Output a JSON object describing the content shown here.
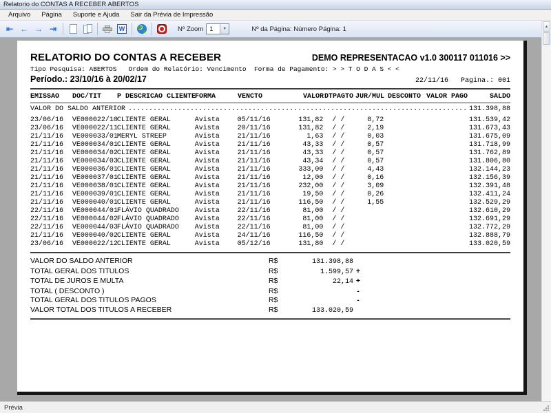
{
  "window": {
    "title": "Relatorio do CONTAS A RECEBER ABERTOS"
  },
  "menu": {
    "items": [
      {
        "label": "Arquivo"
      },
      {
        "label": "Página"
      },
      {
        "label": "Suporte e Ajuda"
      },
      {
        "label": "Sair da Prévia de Impressão"
      }
    ]
  },
  "toolbar": {
    "icons": [
      "first-page-icon",
      "prev-page-icon",
      "next-page-icon",
      "last-page-icon",
      "single-page-icon",
      "two-pages-icon",
      "printer-icon",
      "word-export-icon",
      "globe-icon",
      "pdf-export-icon"
    ],
    "zoom_label": "Nº Zoom",
    "zoom_value": "1",
    "page_info": "Nº da Página: Número Página: 1",
    "colors": {
      "nav_arrow_blue": "#3a6fd2",
      "pdf_red": "#c9201d",
      "word_blue": "#2b50c0"
    }
  },
  "report": {
    "title": "RELATORIO DO CONTAS A RECEBER",
    "demo_header": "DEMO REPRESENTACAO v1.0 300117 011016 >>",
    "filters": "Tipo Pesquisa: ABERTOS   Ordem do Relatório: Vencimento  Forma de Pagamento: > > T O D A S < <",
    "period": "Período.: 23/10/16 à 20/02/17",
    "date_page": "22/11/16   Pagina.: 001",
    "header": {
      "emissao": "EMISSAO",
      "doc": "DOC/TIT",
      "cliente": "P DESCRICAO CLIENTE",
      "forma": "FORMA",
      "vencto": "VENCTO",
      "valor": "VALOR",
      "dtpagto": "DTPAGTO",
      "jur": "JUR/MUL",
      "desconto": "DESCONTO",
      "pago": "VALOR PAGO",
      "saldo": "SALDO"
    },
    "saldo_anterior": {
      "label": "VALOR DO SALDO ANTERIOR",
      "dots": "......................................................................................................................................................",
      "value": "131.398,88"
    },
    "rows": [
      {
        "emissao": "23/06/16",
        "doc": "VE000022/10",
        "cliente": "CLIENTE GERAL",
        "forma": "Avista",
        "vencto": "05/11/16",
        "valor": "131,82",
        "dtpagto": "/ /",
        "jur": "8,72",
        "desconto": "",
        "pago": "",
        "saldo": "131.539,42"
      },
      {
        "emissao": "23/06/16",
        "doc": "VE000022/11",
        "cliente": "CLIENTE GERAL",
        "forma": "Avista",
        "vencto": "20/11/16",
        "valor": "131,82",
        "dtpagto": "/ /",
        "jur": "2,19",
        "desconto": "",
        "pago": "",
        "saldo": "131.673,43"
      },
      {
        "emissao": "21/11/16",
        "doc": "VE000033/01",
        "cliente": "MERYL STREEP",
        "forma": "Avista",
        "vencto": "21/11/16",
        "valor": "1,63",
        "dtpagto": "/ /",
        "jur": "0,03",
        "desconto": "",
        "pago": "",
        "saldo": "131.675,09"
      },
      {
        "emissao": "21/11/16",
        "doc": "VE000034/01",
        "cliente": "CLIENTE GERAL",
        "forma": "Avista",
        "vencto": "21/11/16",
        "valor": "43,33",
        "dtpagto": "/ /",
        "jur": "0,57",
        "desconto": "",
        "pago": "",
        "saldo": "131.718,99"
      },
      {
        "emissao": "21/11/16",
        "doc": "VE000034/02",
        "cliente": "CLIENTE GERAL",
        "forma": "Avista",
        "vencto": "21/11/16",
        "valor": "43,33",
        "dtpagto": "/ /",
        "jur": "0,57",
        "desconto": "",
        "pago": "",
        "saldo": "131.762,89"
      },
      {
        "emissao": "21/11/16",
        "doc": "VE000034/03",
        "cliente": "CLIENTE GERAL",
        "forma": "Avista",
        "vencto": "21/11/16",
        "valor": "43,34",
        "dtpagto": "/ /",
        "jur": "0,57",
        "desconto": "",
        "pago": "",
        "saldo": "131.806,80"
      },
      {
        "emissao": "21/11/16",
        "doc": "VE000036/01",
        "cliente": "CLIENTE GERAL",
        "forma": "Avista",
        "vencto": "21/11/16",
        "valor": "333,00",
        "dtpagto": "/ /",
        "jur": "4,43",
        "desconto": "",
        "pago": "",
        "saldo": "132.144,23"
      },
      {
        "emissao": "21/11/16",
        "doc": "VE000037/01",
        "cliente": "CLIENTE GERAL",
        "forma": "Avista",
        "vencto": "21/11/16",
        "valor": "12,00",
        "dtpagto": "/ /",
        "jur": "0,16",
        "desconto": "",
        "pago": "",
        "saldo": "132.156,39"
      },
      {
        "emissao": "21/11/16",
        "doc": "VE000038/01",
        "cliente": "CLIENTE GERAL",
        "forma": "Avista",
        "vencto": "21/11/16",
        "valor": "232,00",
        "dtpagto": "/ /",
        "jur": "3,09",
        "desconto": "",
        "pago": "",
        "saldo": "132.391,48"
      },
      {
        "emissao": "21/11/16",
        "doc": "VE000039/01",
        "cliente": "CLIENTE GERAL",
        "forma": "Avista",
        "vencto": "21/11/16",
        "valor": "19,50",
        "dtpagto": "/ /",
        "jur": "0,26",
        "desconto": "",
        "pago": "",
        "saldo": "132.411,24"
      },
      {
        "emissao": "21/11/16",
        "doc": "VE000040/01",
        "cliente": "CLIENTE GERAL",
        "forma": "Avista",
        "vencto": "21/11/16",
        "valor": "116,50",
        "dtpagto": "/ /",
        "jur": "1,55",
        "desconto": "",
        "pago": "",
        "saldo": "132.529,29"
      },
      {
        "emissao": "22/11/16",
        "doc": "VE000044/01",
        "cliente": "FLÁVIO QUADRADO",
        "forma": "Avista",
        "vencto": "22/11/16",
        "valor": "81,00",
        "dtpagto": "/ /",
        "jur": "",
        "desconto": "",
        "pago": "",
        "saldo": "132.610,29"
      },
      {
        "emissao": "22/11/16",
        "doc": "VE000044/02",
        "cliente": "FLÁVIO QUADRADO",
        "forma": "Avista",
        "vencto": "22/11/16",
        "valor": "81,00",
        "dtpagto": "/ /",
        "jur": "",
        "desconto": "",
        "pago": "",
        "saldo": "132.691,29"
      },
      {
        "emissao": "22/11/16",
        "doc": "VE000044/03",
        "cliente": "FLÁVIO QUADRADO",
        "forma": "Avista",
        "vencto": "22/11/16",
        "valor": "81,00",
        "dtpagto": "/ /",
        "jur": "",
        "desconto": "",
        "pago": "",
        "saldo": "132.772,29"
      },
      {
        "emissao": "21/11/16",
        "doc": "VE000040/02",
        "cliente": "CLIENTE GERAL",
        "forma": "Avista",
        "vencto": "24/11/16",
        "valor": "116,50",
        "dtpagto": "/ /",
        "jur": "",
        "desconto": "",
        "pago": "",
        "saldo": "132.888,79"
      },
      {
        "emissao": "23/06/16",
        "doc": "VE000022/12",
        "cliente": "CLIENTE GERAL",
        "forma": "Avista",
        "vencto": "05/12/16",
        "valor": "131,80",
        "dtpagto": "/ /",
        "jur": "",
        "desconto": "",
        "pago": "",
        "saldo": "133.020,59"
      }
    ],
    "totals": [
      {
        "label": "VALOR DO SALDO ANTERIOR",
        "currency": "R$",
        "value": "131.398,88",
        "sign": ""
      },
      {
        "label": "TOTAL GERAL DOS TITULOS",
        "currency": "R$",
        "value": "1.599,57",
        "sign": "+"
      },
      {
        "label": "TOTAL DE JUROS E MULTA",
        "currency": "R$",
        "value": "22,14",
        "sign": "+"
      },
      {
        "label": "TOTAL ( DESCONTO )",
        "currency": "R$",
        "value": "",
        "sign": "-"
      },
      {
        "label": "TOTAL GERAL DOS TITULOS PAGOS",
        "currency": "R$",
        "value": "",
        "sign": "-"
      },
      {
        "label": "VALOR TOTAL DOS TITULOS A RECEBER",
        "currency": "R$",
        "value": "133.020,59",
        "sign": ""
      }
    ]
  },
  "statusbar": {
    "text": "Prévia"
  }
}
